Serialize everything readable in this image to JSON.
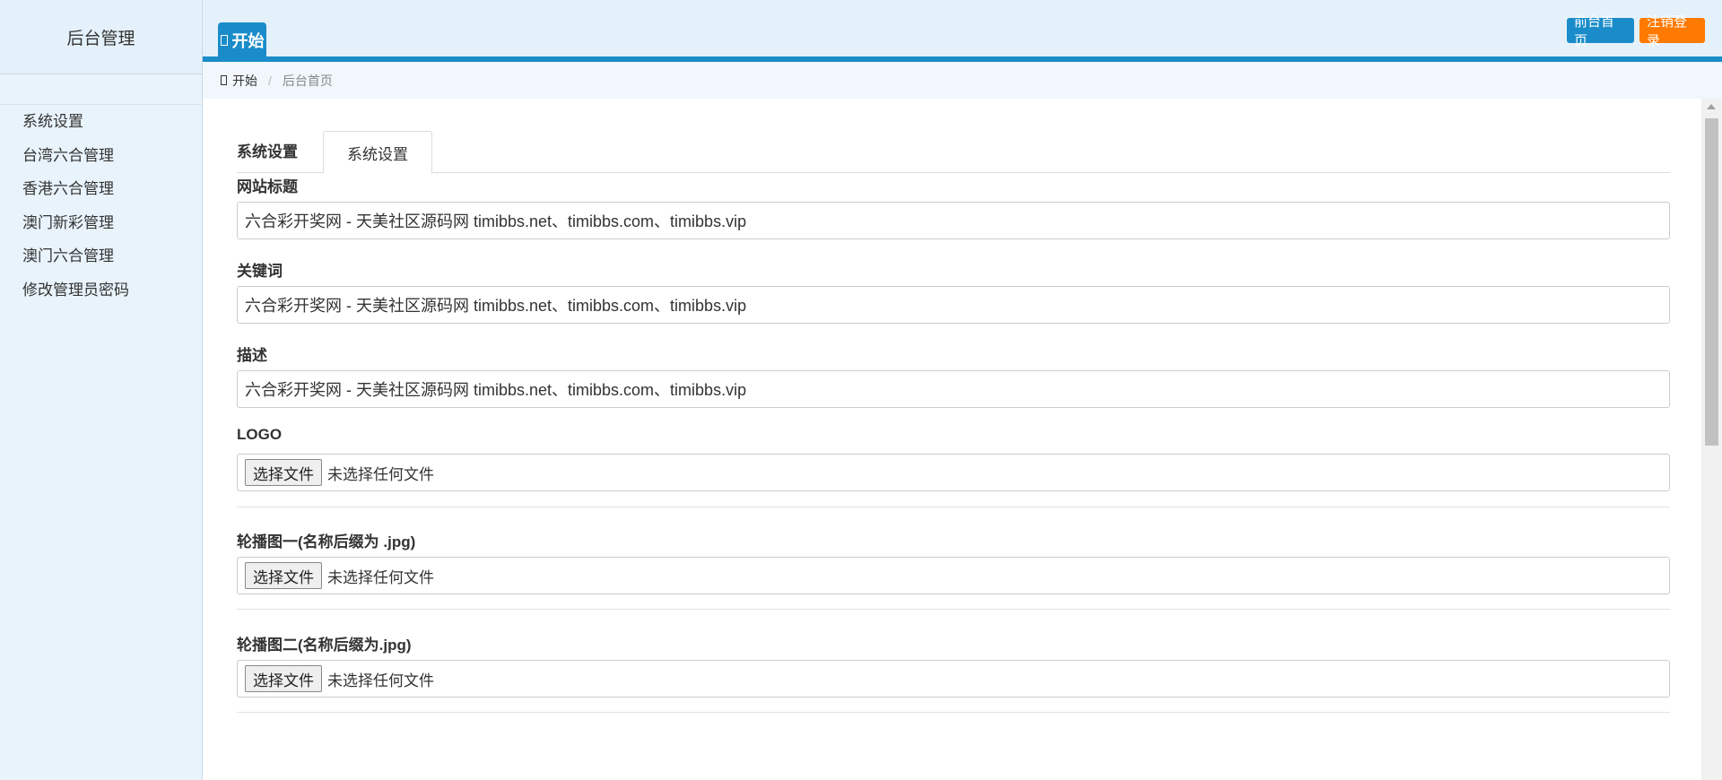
{
  "header": {
    "app_title": "后台管理",
    "start_tab": "开始",
    "front_button": "前台首页",
    "logout_button": "注销登录"
  },
  "sidebar": {
    "items": [
      {
        "label": "系统设置"
      },
      {
        "label": "台湾六合管理"
      },
      {
        "label": "香港六合管理"
      },
      {
        "label": "澳门新彩管理"
      },
      {
        "label": "澳门六合管理"
      },
      {
        "label": "修改管理员密码"
      }
    ]
  },
  "breadcrumb": {
    "home": "开始",
    "separator": "/",
    "current": "后台首页"
  },
  "main": {
    "tab_heading": "系统设置",
    "active_tab": "系统设置",
    "fields": {
      "site_title": {
        "label": "网站标题",
        "value": "六合彩开奖网 - 天美社区源码网 timibbs.net、timibbs.com、timibbs.vip"
      },
      "keywords": {
        "label": "关键词",
        "value": "六合彩开奖网 - 天美社区源码网 timibbs.net、timibbs.com、timibbs.vip"
      },
      "description": {
        "label": "描述",
        "value": "六合彩开奖网 - 天美社区源码网 timibbs.net、timibbs.com、timibbs.vip"
      },
      "logo": {
        "label": "LOGO",
        "button": "选择文件",
        "status": "未选择任何文件"
      },
      "banner1": {
        "label": "轮播图一(名称后缀为 .jpg)",
        "button": "选择文件",
        "status": "未选择任何文件"
      },
      "banner2": {
        "label": "轮播图二(名称后缀为.jpg)",
        "button": "选择文件",
        "status": "未选择任何文件"
      }
    }
  },
  "colors": {
    "primary": "#1a8cc9",
    "logout": "#ff7a00",
    "header_bg": "#e4f1fa",
    "sidebar_bg": "#e8f3fb"
  }
}
